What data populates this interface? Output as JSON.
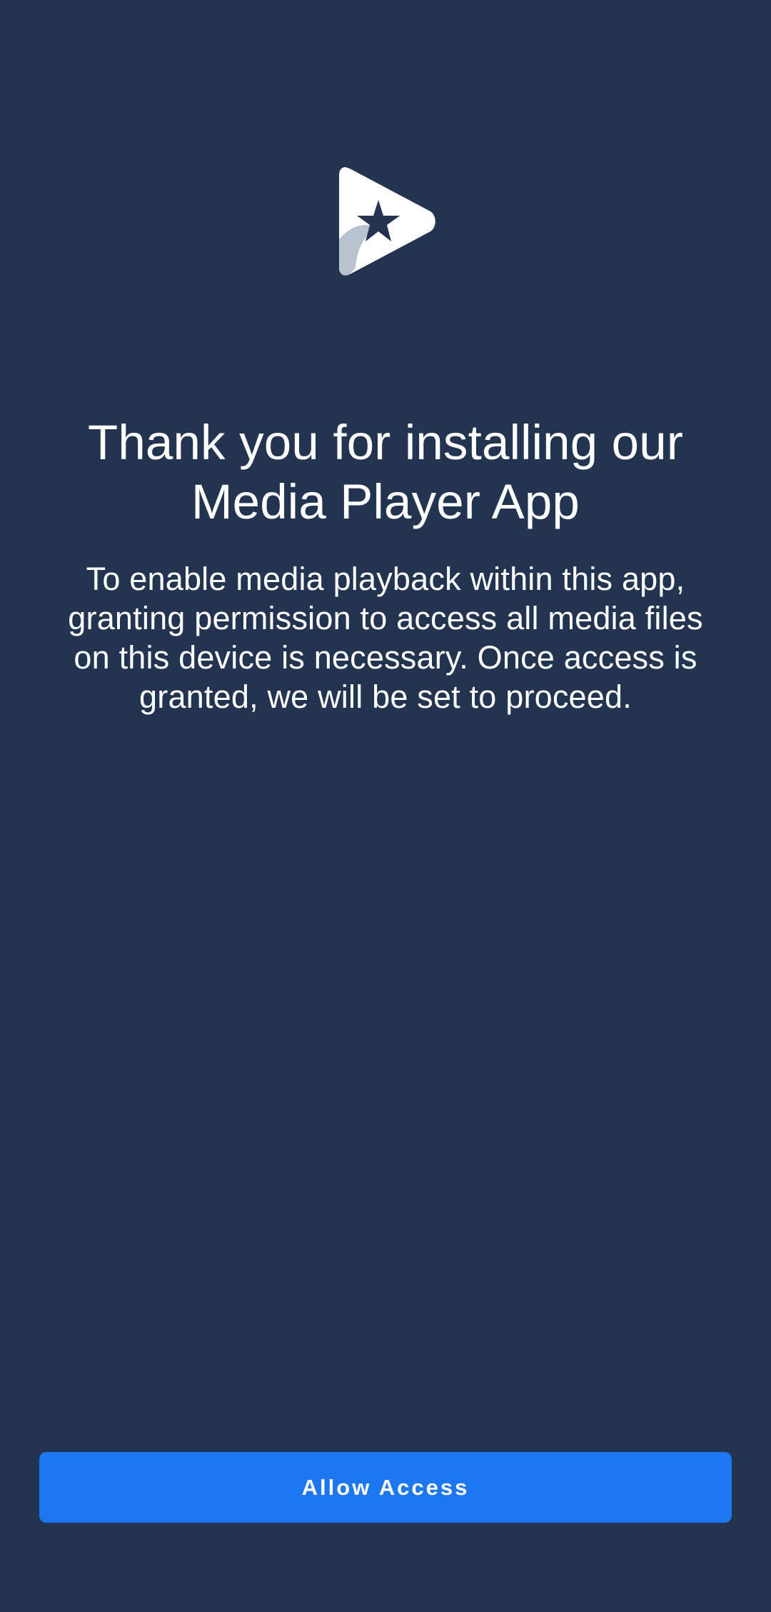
{
  "app": {
    "logo_icon": "play-star-icon",
    "background_color": "#22344f",
    "accent_color": "#1c77f0"
  },
  "welcome": {
    "headline": "Thank you for installing our Media Player App",
    "description": "To enable media playback within this app, granting permission to access all media files on this device is necessary. Once access is granted, we will be set to proceed."
  },
  "actions": {
    "allow_label": "Allow Access"
  }
}
